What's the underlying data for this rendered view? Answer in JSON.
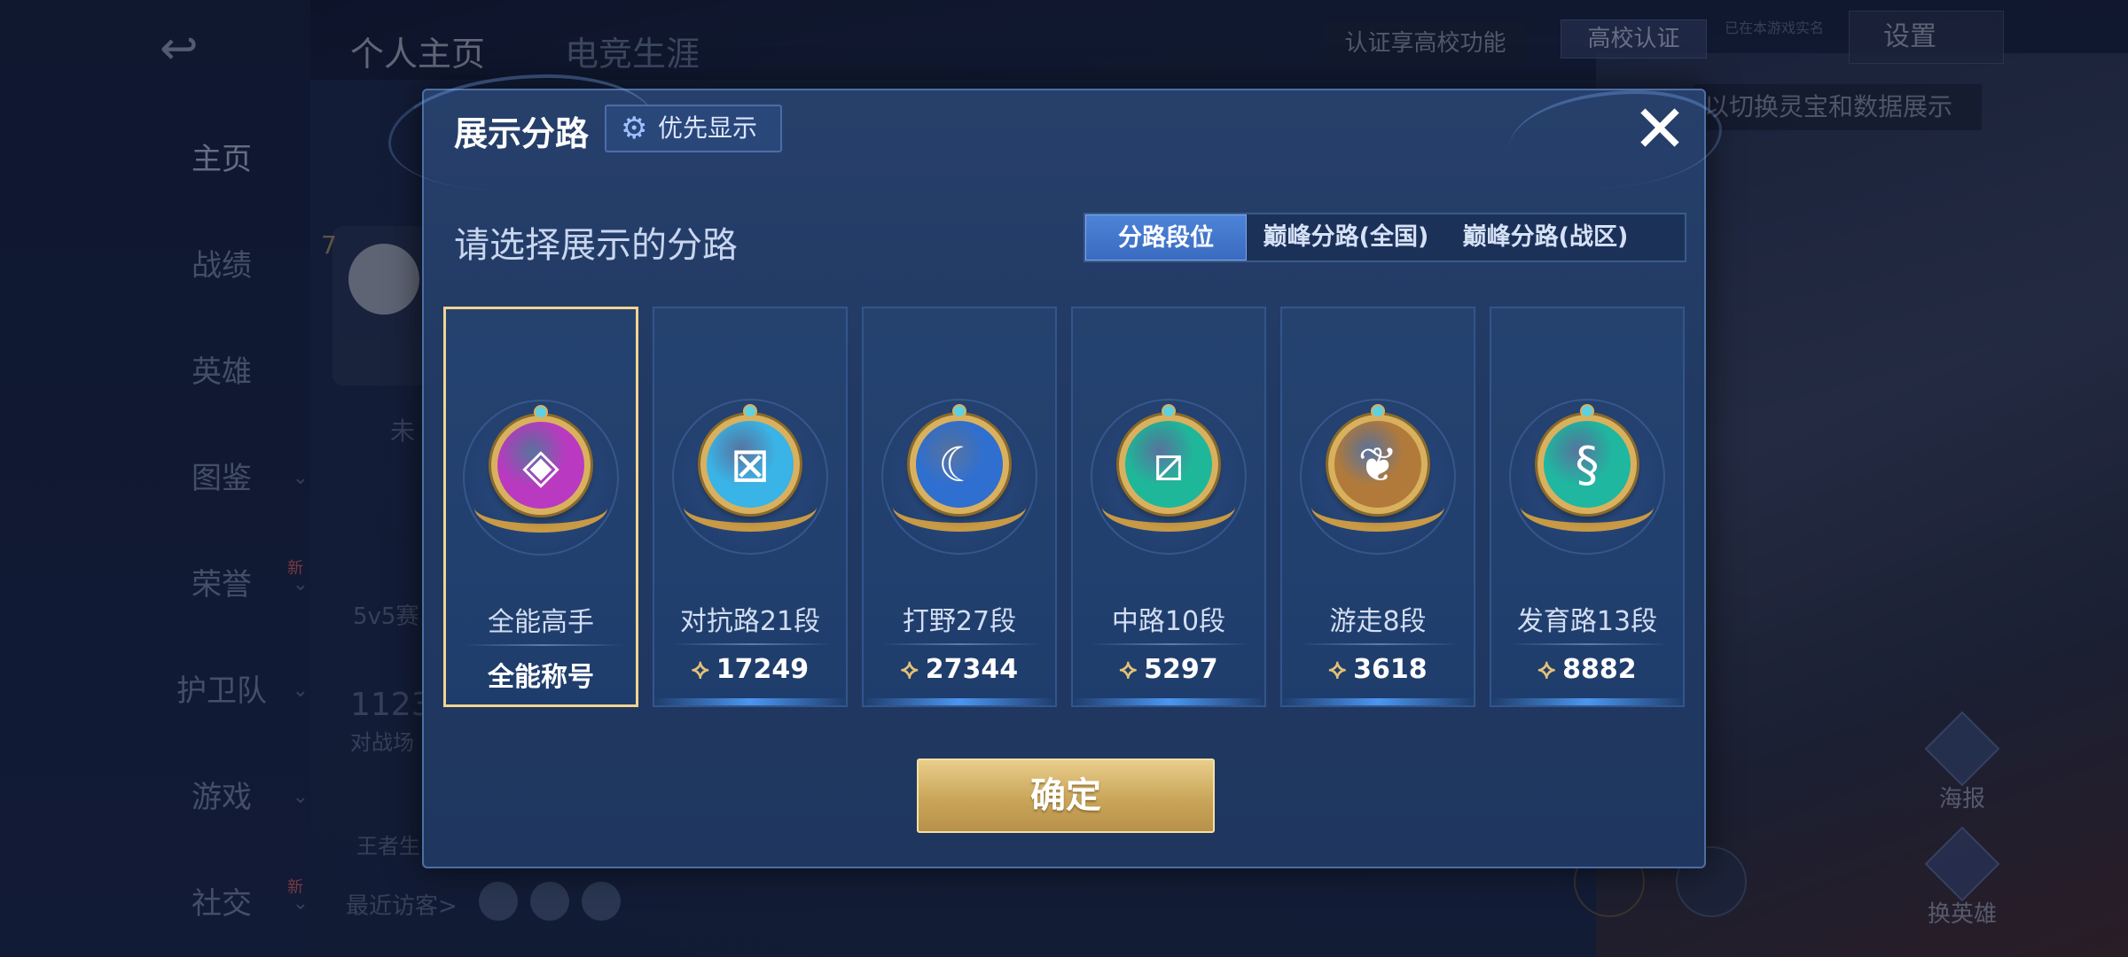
{
  "background": {
    "top_tabs": [
      "个人主页",
      "电竞生涯"
    ],
    "cert_hint": "认证享高校功能",
    "cert_badge": "高校认证",
    "realname_note": "已在本游戏实名",
    "settings": "设置",
    "switch_hint": "以切换灵宝和数据展示",
    "side_nav": [
      {
        "label": "主页",
        "has_chevron": false,
        "new": ""
      },
      {
        "label": "战绩",
        "has_chevron": false,
        "new": ""
      },
      {
        "label": "英雄",
        "has_chevron": false,
        "new": ""
      },
      {
        "label": "图鉴",
        "has_chevron": true,
        "new": ""
      },
      {
        "label": "荣誉",
        "has_chevron": true,
        "new": "新"
      },
      {
        "label": "护卫队",
        "has_chevron": true,
        "new": ""
      },
      {
        "label": "游戏",
        "has_chevron": true,
        "new": ""
      },
      {
        "label": "社交",
        "has_chevron": true,
        "new": "新"
      }
    ],
    "avatar_level": "7",
    "fragments": [
      "未",
      "5v5赛",
      "1123",
      "对战场",
      "王者生"
    ],
    "recent_visitors": "最近访客>",
    "right_icons": [
      "海报",
      "换英雄"
    ]
  },
  "modal": {
    "title": "展示分路",
    "priority_button": "优先显示",
    "close_symbol": "✕",
    "subtitle": "请选择展示的分路",
    "segments": [
      "分路段位",
      "巅峰分路(全国)",
      "巅峰分路(战区)"
    ],
    "active_segment": 0,
    "cards": [
      {
        "label": "全能高手",
        "value": "全能称号",
        "show_points_icon": false,
        "color": "#b93ac0",
        "glyph": "◈",
        "selected": true
      },
      {
        "label": "对抗路21段",
        "value": "17249",
        "show_points_icon": true,
        "color": "#3ab3e6",
        "glyph": "⊠",
        "selected": false
      },
      {
        "label": "打野27段",
        "value": "27344",
        "show_points_icon": true,
        "color": "#2f6fd0",
        "glyph": "☾",
        "selected": false
      },
      {
        "label": "中路10段",
        "value": "5297",
        "show_points_icon": true,
        "color": "#1fb79a",
        "glyph": "⧄",
        "selected": false
      },
      {
        "label": "游走8段",
        "value": "3618",
        "show_points_icon": true,
        "color": "#b27a3a",
        "glyph": "❦",
        "selected": false
      },
      {
        "label": "发育路13段",
        "value": "8882",
        "show_points_icon": true,
        "color": "#1fb7a0",
        "glyph": "§",
        "selected": false
      }
    ],
    "confirm": "确定"
  },
  "colors": {
    "accent_gold": "#e9cd8a",
    "selected_border": "#f1d48e",
    "active_tab": "#4d84d8"
  }
}
